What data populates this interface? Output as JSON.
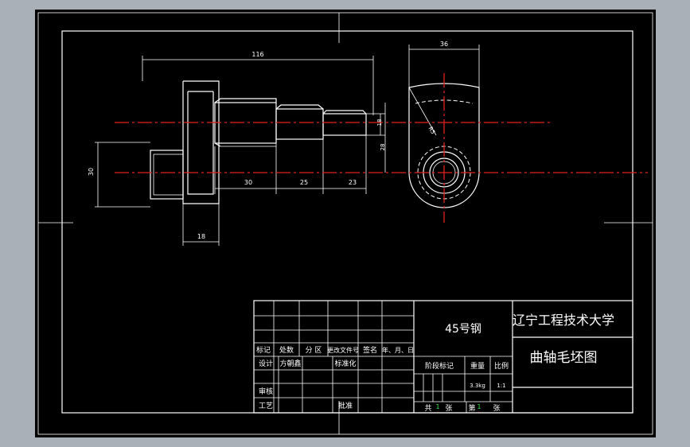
{
  "colors": {
    "frame": "#a9b0b7",
    "sheet": "#000000",
    "lines": "#ffffff",
    "centerlines": "#e0201e",
    "sheet_numbers": "#38e23a"
  },
  "dimensions": {
    "overall_length": "116",
    "diameter_left": "30",
    "width_right": "36",
    "seg_30": "30",
    "seg_25": "25",
    "seg_23": "23",
    "len_18": "18",
    "dia_18": "18",
    "dia_28": "28",
    "radius": "R5"
  },
  "title_block": {
    "material": "45号钢",
    "school": "辽宁工程技术大学",
    "drawing_name": "曲轴毛坯图",
    "row_labels": {
      "mark": "标记",
      "count": "处数",
      "zone": "分 区",
      "change_doc": "更改文件号",
      "signature": "签名",
      "date": "年、月、日"
    },
    "design_label": "设计",
    "designer": "方朝鑫",
    "standardize_label": "标准化",
    "review_label": "审核",
    "process_label": "工艺",
    "approve_label": "批准",
    "stage_label": "阶段标记",
    "weight_label": "重量",
    "scale_label": "比例",
    "weight": "3.3kg",
    "scale": "1:1",
    "total_prefix": "共",
    "total_sheets": "1",
    "sheet_unit": "张",
    "sheet_prefix": "第",
    "sheet_no": "1",
    "sheet_unit2": "张"
  }
}
